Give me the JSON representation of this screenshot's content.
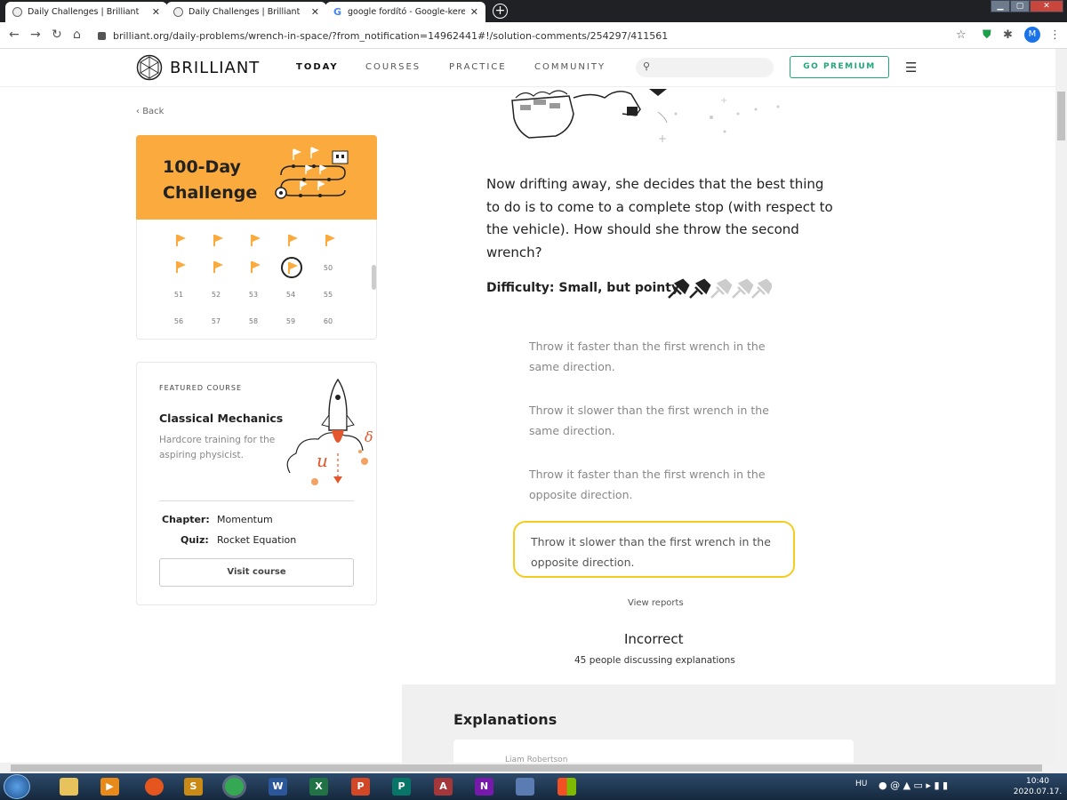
{
  "browser": {
    "tabs": [
      {
        "title": "Daily Challenges | Brilliant"
      },
      {
        "title": "Daily Challenges | Brilliant"
      },
      {
        "title": "google fordító - Google-keresés"
      }
    ],
    "url": "brilliant.org/daily-problems/wrench-in-space/?from_notification=14962441#!/solution-comments/254297/411561",
    "profile_initial": "M"
  },
  "header": {
    "logo": "BRILLIANT",
    "nav": [
      "TODAY",
      "COURSES",
      "PRACTICE",
      "COMMUNITY"
    ],
    "active_nav": "TODAY",
    "premium_label": "GO PREMIUM"
  },
  "sidebar": {
    "back_label": "Back",
    "challenge": {
      "title_line1": "100-Day",
      "title_line2": "Challenge",
      "row2_last": "50",
      "row3": [
        "51",
        "52",
        "53",
        "54",
        "55"
      ],
      "row4": [
        "56",
        "57",
        "58",
        "59",
        "60"
      ]
    },
    "featured": {
      "label": "FEATURED COURSE",
      "title": "Classical Mechanics",
      "description": "Hardcore training for the aspiring physicist.",
      "chapter_label": "Chapter:",
      "chapter_value": "Momentum",
      "quiz_label": "Quiz:",
      "quiz_value": "Rocket Equation",
      "visit_label": "Visit course"
    }
  },
  "problem": {
    "question": "Now drifting away, she decides that the best thing to do is to come to a complete stop (with respect to the vehicle). How should she throw the second wrench?",
    "difficulty_label": "Difficulty: Small, but pointy",
    "difficulty_level": 2,
    "difficulty_max": 5,
    "options": [
      {
        "text": "Throw it faster than the first wrench in the same direction."
      },
      {
        "text": "Throw it slower than the first wrench in the same direction."
      },
      {
        "text": "Throw it faster than the first wrench in the opposite direction."
      },
      {
        "text": "Throw it slower than the first wrench in the opposite direction."
      }
    ],
    "selected_option": 4,
    "view_reports": "View reports",
    "result": "Incorrect",
    "discussion": "45 people discussing explanations"
  },
  "explanations": {
    "title": "Explanations",
    "first_author": "Liam Robertson"
  },
  "taskbar": {
    "lang": "HU",
    "time": "10:40",
    "date": "2020.07.17."
  },
  "colors": {
    "challenge_orange": "#fbab3d",
    "premium_green": "#21a67a",
    "selected_outline": "#f2cd20"
  }
}
